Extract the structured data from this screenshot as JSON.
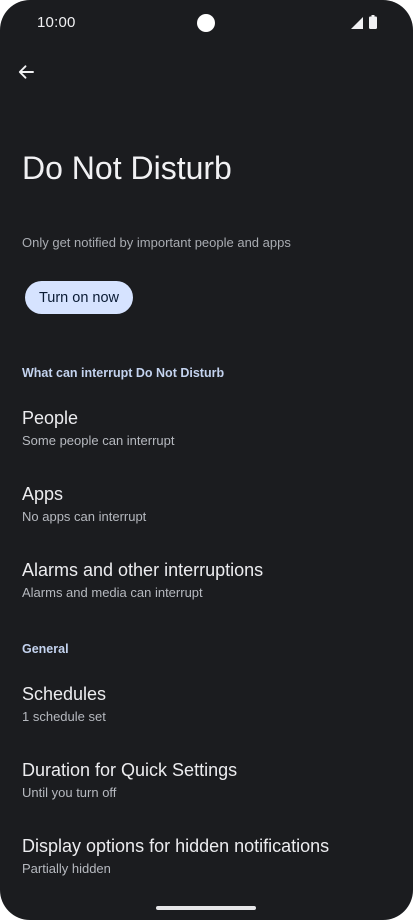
{
  "status_bar": {
    "time": "10:00"
  },
  "toolbar": {
    "back_icon": "arrow-back-icon"
  },
  "header": {
    "title": "Do Not Disturb",
    "description": "Only get notified by important people and apps"
  },
  "primary_action": {
    "label": "Turn on now"
  },
  "sections": {
    "interrupt": {
      "header": "What can interrupt Do Not Disturb",
      "items": [
        {
          "title": "People",
          "subtitle": "Some people can interrupt"
        },
        {
          "title": "Apps",
          "subtitle": "No apps can interrupt"
        },
        {
          "title": "Alarms and other interruptions",
          "subtitle": "Alarms and media can interrupt"
        }
      ]
    },
    "general": {
      "header": "General",
      "items": [
        {
          "title": "Schedules",
          "subtitle": "1 schedule set"
        },
        {
          "title": "Duration for Quick Settings",
          "subtitle": "Until you turn off"
        },
        {
          "title": "Display options for hidden notifications",
          "subtitle": "Partially hidden"
        }
      ]
    }
  },
  "colors": {
    "background": "#1b1c1f",
    "button_fill": "#d6e3ff",
    "section_header": "#c4d3ef"
  }
}
